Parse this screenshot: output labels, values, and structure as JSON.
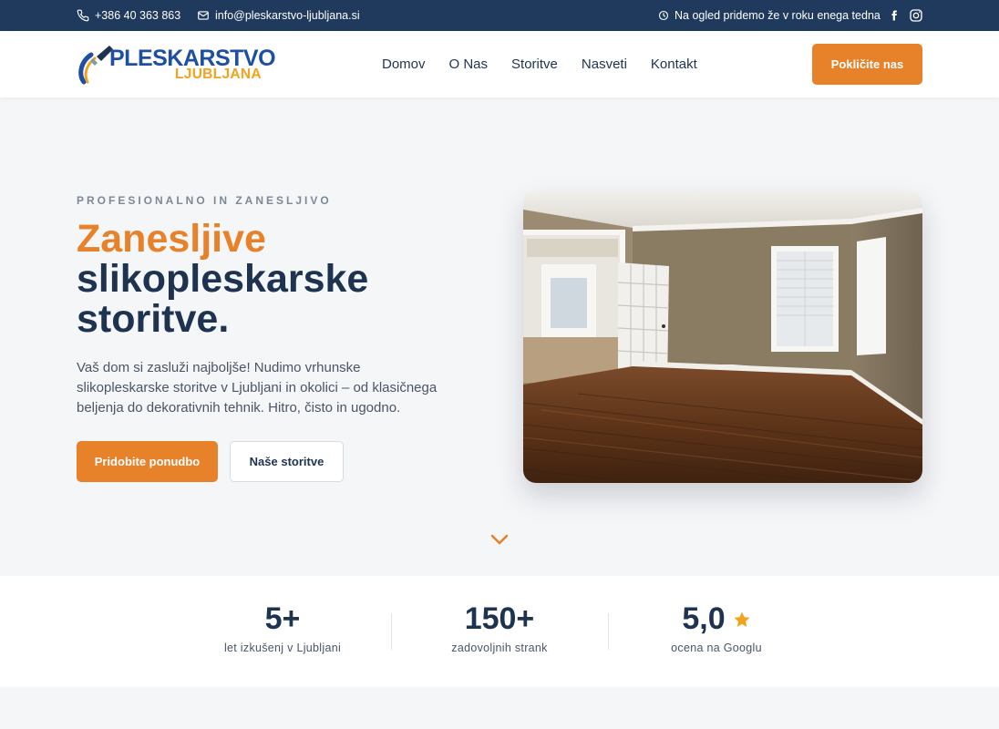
{
  "topbar": {
    "phone": "+386 40 363 863",
    "email": "info@pleskarstvo-ljubljana.si",
    "notice": "Na ogled pridemo že v roku enega tedna",
    "icons": [
      "phone-icon",
      "mail-icon",
      "clock-icon",
      "facebook-icon",
      "instagram-icon"
    ]
  },
  "header": {
    "logo_top": "PLESKARSTVO",
    "logo_bottom": "LJUBLJANA",
    "nav": [
      {
        "label": "Domov"
      },
      {
        "label": "O Nas"
      },
      {
        "label": "Storitve"
      },
      {
        "label": "Nasveti"
      },
      {
        "label": "Kontakt"
      }
    ],
    "cta": "Pokličite nas"
  },
  "hero": {
    "eyebrow": "PROFESIONALNO IN ZANESLJIVO",
    "title_accent": "Zanesljive",
    "title_rest_1": "slikopleskarske",
    "title_rest_2": "storitve.",
    "description": "Vaš dom si zasluži najboljše! Nudimo vrhunske slikopleskarske storitve v Ljubljani in okolici – od klasičnega beljenja do dekorativnih tehnik. Hitro, čisto in ugodno.",
    "primary_button": "Pridobite ponudbo",
    "secondary_button": "Naše storitve"
  },
  "stats": [
    {
      "value": "5+",
      "label": "let izkušenj v Ljubljani"
    },
    {
      "value": "150+",
      "label": "zadovoljnih strank"
    },
    {
      "value": "5,0",
      "label": "ocena na Googlu"
    }
  ],
  "colors": {
    "navy": "#1f3a5c",
    "accent": "#e8822a",
    "star": "#f2a31b"
  }
}
